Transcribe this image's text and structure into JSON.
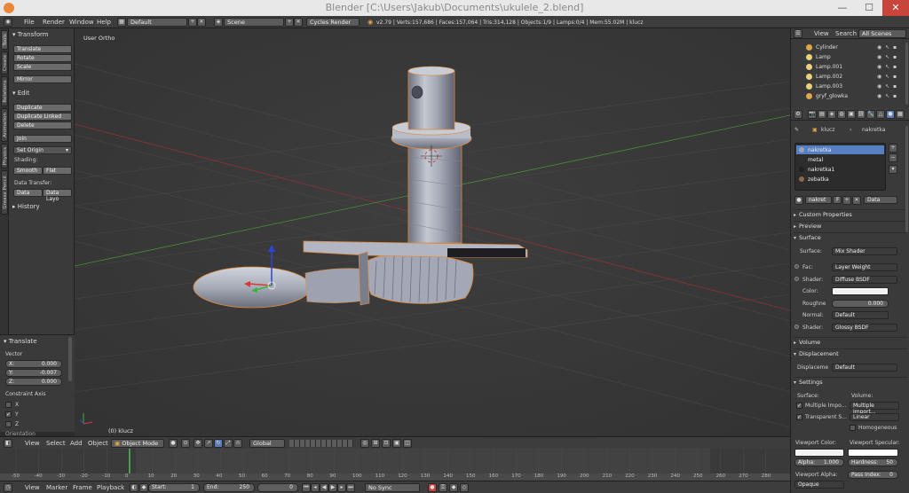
{
  "window": {
    "title": "Blender [C:\\Users\\Jakub\\Documents\\ukulele_2.blend]",
    "minimize": "—",
    "maximize": "☐",
    "close": "✕"
  },
  "info_header": {
    "menus": [
      "File",
      "Render",
      "Window",
      "Help"
    ],
    "screen_layout": "Default",
    "scene": "Scene",
    "render_engine": "Cycles Render",
    "stats": "v2.79 | Verts:157,686 | Faces:157,064 | Tris:314,128 | Objects:1/9 | Lamps:0/4 | Mem:55.02M | klucz"
  },
  "tool_tabs": [
    "Tools",
    "Create",
    "Relations",
    "Animation",
    "Physics",
    "Grease Pencil"
  ],
  "tool_shelf": {
    "transform_header": "Transform",
    "transform_buttons": [
      "Translate",
      "Rotate",
      "Scale"
    ],
    "mirror": "Mirror",
    "edit_header": "Edit",
    "edit_buttons": [
      "Duplicate",
      "Duplicate Linked",
      "Delete"
    ],
    "join": "Join",
    "set_origin": "Set Origin",
    "shading_label": "Shading:",
    "smooth": "Smooth",
    "flat": "Flat",
    "data_transfer_label": "Data Transfer:",
    "data": "Data",
    "data_layout": "Data Layo",
    "history_header": "History"
  },
  "operator_panel": {
    "header": "Translate",
    "vector_label": "Vector",
    "x_label": "X:",
    "x_value": "0.000",
    "y_label": "Y:",
    "y_value": "-0.007",
    "z_label": "Z:",
    "z_value": "0.000",
    "constraint_label": "Constraint Axis",
    "axes": [
      "X",
      "Y",
      "Z"
    ],
    "axes_checked": [
      false,
      true,
      false
    ],
    "orientation_label": "Orientation"
  },
  "viewport": {
    "view_name": "User Ortho",
    "object_label": "(0) klucz"
  },
  "viewport_header": {
    "menus": [
      "View",
      "Select",
      "Add",
      "Object"
    ],
    "mode": "Object Mode",
    "orientation": "Global"
  },
  "timeline": {
    "ticks": [
      "-50",
      "-40",
      "-30",
      "-20",
      "-10",
      "0",
      "10",
      "20",
      "30",
      "40",
      "50",
      "60",
      "70",
      "80",
      "90",
      "100",
      "110",
      "120",
      "130",
      "140",
      "150",
      "160",
      "170",
      "180",
      "190",
      "200",
      "210",
      "220",
      "230",
      "240",
      "250",
      "260",
      "270",
      "280"
    ],
    "current_frame": 0
  },
  "timeline_header": {
    "menus": [
      "View",
      "Marker",
      "Frame",
      "Playback"
    ],
    "start_label": "Start:",
    "start_value": "1",
    "end_label": "End:",
    "end_value": "250",
    "current_value": "0",
    "sync": "No Sync"
  },
  "outliner": {
    "menus": [
      "View",
      "Search",
      "All Scenes"
    ],
    "items": [
      {
        "name": "Cylinder",
        "color": "#e0a64a"
      },
      {
        "name": "Lamp",
        "color": "#e8d27a"
      },
      {
        "name": "Lamp.001",
        "color": "#e8d27a"
      },
      {
        "name": "Lamp.002",
        "color": "#e8d27a"
      },
      {
        "name": "Lamp.003",
        "color": "#e8d27a"
      },
      {
        "name": "gryf_glowka",
        "color": "#e0a64a"
      }
    ]
  },
  "properties": {
    "breadcrumb_object": "klucz",
    "breadcrumb_material": "nakretka",
    "material_slots": [
      {
        "name": "nakretka",
        "color": "#9aa4b4",
        "selected": true
      },
      {
        "name": "metal",
        "color": "#2e2e2e",
        "selected": false
      },
      {
        "name": "nakretka1",
        "color": "#202020",
        "selected": false
      },
      {
        "name": "zebatka",
        "color": "#8a6a4a",
        "selected": false
      }
    ],
    "material_name": "nakret",
    "material_users": "F",
    "link": "Data",
    "sections": {
      "custom_properties": "Custom Properties",
      "preview": "Preview",
      "surface": "Surface",
      "volume": "Volume",
      "displacement": "Displacement",
      "settings": "Settings"
    },
    "surface_label": "Surface:",
    "surface_value": "Mix Shader",
    "fac_label": "Fac:",
    "fac_value": "Layer Weight",
    "shader1_label": "Shader:",
    "shader1_value": "Diffuse BSDF",
    "color_label": "Color:",
    "roughness_label": "Roughne",
    "roughness_value": "0.000",
    "normal_label": "Normal:",
    "normal_value": "Default",
    "shader2_label": "Shader:",
    "shader2_value": "Glossy BSDF",
    "displacement_label": "Displaceme",
    "displacement_value": "Default",
    "settings_surface_label": "Surface:",
    "settings_volume_label": "Volume:",
    "multiple_importance": "Multiple Impo...",
    "transparent_shadows": "Transparent S...",
    "volume_sampling": "Multiple Import...",
    "volume_interpolation": "Linear",
    "homogeneous": "Homogeneous",
    "viewport_color_label": "Viewport Color:",
    "viewport_specular_label": "Viewport Specular:",
    "alpha_label": "Alpha:",
    "alpha_value": "1.000",
    "hardness_label": "Hardness:",
    "hardness_value": "50",
    "viewport_alpha_label": "Viewport Alpha:",
    "viewport_alpha_value": "Opaque",
    "pass_index_label": "Pass Index:",
    "pass_index_value": "0"
  }
}
